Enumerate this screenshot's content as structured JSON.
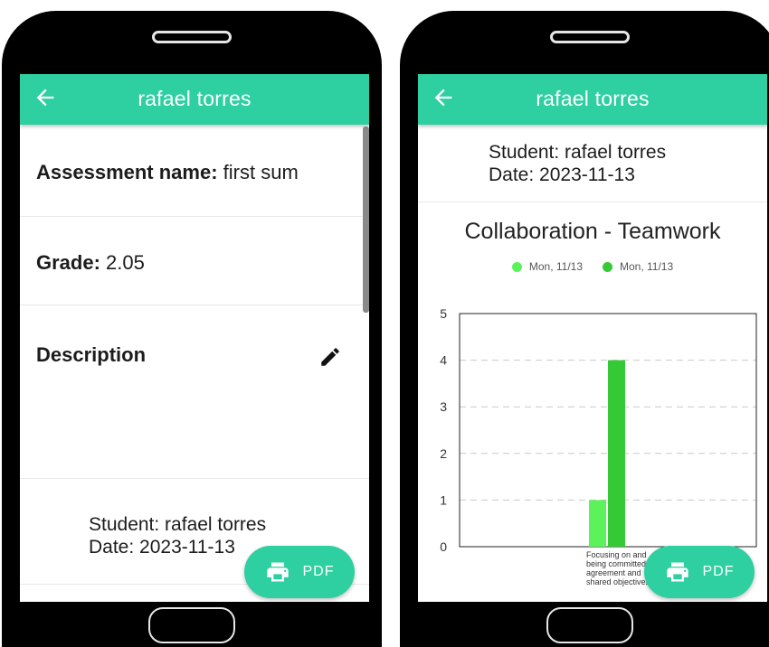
{
  "left_screen": {
    "appbar": {
      "title": "rafael torres",
      "back_icon": "arrow-left-icon"
    },
    "assessment": {
      "label": "Assessment name:",
      "value": " first sum"
    },
    "grade": {
      "label": "Grade:",
      "value": " 2.05"
    },
    "description": {
      "label": "Description",
      "edit_icon": "pencil-icon"
    },
    "student_line": "Student: rafael torres",
    "date_line": "Date: 2023-11-13",
    "fab": {
      "label": "PDF",
      "icon": "printer-icon"
    }
  },
  "right_screen": {
    "appbar": {
      "title": "rafael torres",
      "back_icon": "arrow-left-icon"
    },
    "student_line": "Student: rafael torres",
    "date_line": "Date: 2023-11-13",
    "fab": {
      "label": "PDF",
      "icon": "printer-icon"
    }
  },
  "colors": {
    "accent": "#2ecfa0",
    "series_1": "#5cf25c",
    "series_2": "#36c936"
  },
  "chart_data": {
    "type": "bar",
    "title": "Collaboration - Teamwork",
    "categories": [
      "Focusing on and being committed to agreement and shared objectives."
    ],
    "category_lines": [
      "Focusing on and",
      "being committed to",
      "agreement and",
      "shared objectives."
    ],
    "series": [
      {
        "name": "Mon, 11/13",
        "values": [
          1
        ],
        "color": "#5cf25c"
      },
      {
        "name": "Mon, 11/13",
        "values": [
          4
        ],
        "color": "#36c936"
      }
    ],
    "ylim": [
      0,
      5
    ],
    "yticks": [
      0,
      1,
      2,
      3,
      4,
      5
    ],
    "grid": true,
    "legend": "top-center"
  }
}
